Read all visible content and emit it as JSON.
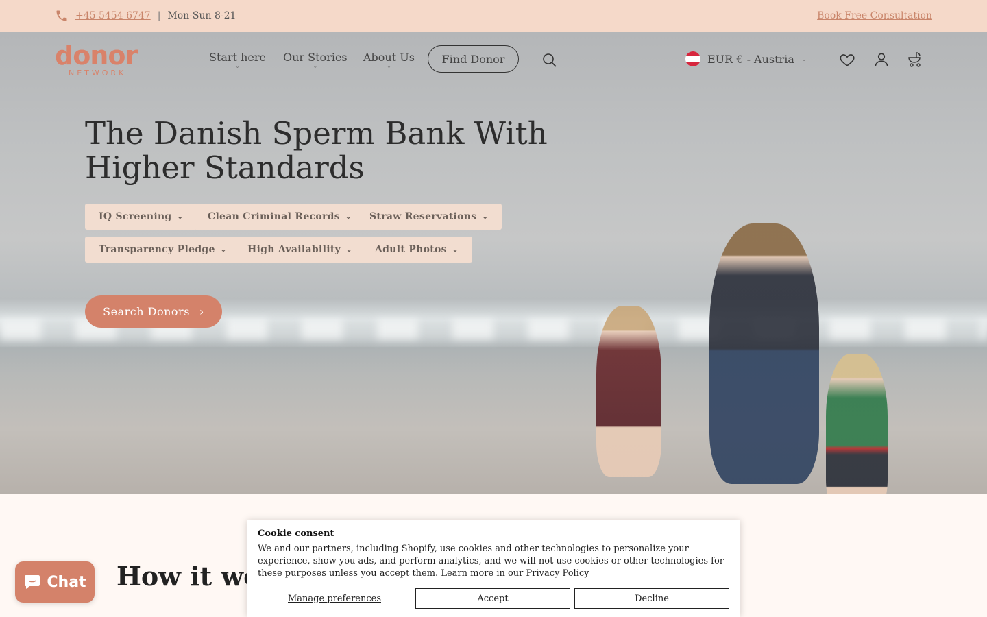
{
  "topbar": {
    "phone": "+45 5454 6747",
    "separator": "|",
    "hours": "Mon-Sun 8-21",
    "consult": "Book Free Consultation"
  },
  "nav": {
    "logo_word": "donor",
    "logo_sub": "NETWORK",
    "items": [
      "Start here",
      "Our Stories",
      "About Us"
    ],
    "find_donor": "Find Donor",
    "currency": "EUR € - Austria"
  },
  "hero": {
    "title": "The Danish Sperm Bank With Higher Standards",
    "pills": [
      "IQ Screening",
      "Clean Criminal Records",
      "Straw Reservations",
      "Transparency Pledge",
      "High Availability",
      "Adult Photos"
    ],
    "cta": "Search Donors"
  },
  "section": {
    "heading": "How it works"
  },
  "chat": {
    "label": "Chat"
  },
  "cookie": {
    "title": "Cookie consent",
    "text": "We and our partners, including Shopify, use cookies and other technologies to personalize your experience, show you ads, and perform analytics, and we will not use cookies or other technologies for these purposes unless you accept them. Learn more in our ",
    "link": "Privacy Policy",
    "manage": "Manage preferences",
    "accept": "Accept",
    "decline": "Decline"
  },
  "colors": {
    "accent": "#d4826a",
    "topbar_bg": "#f5d9c9",
    "pill_bg": "#f2ddd0"
  }
}
